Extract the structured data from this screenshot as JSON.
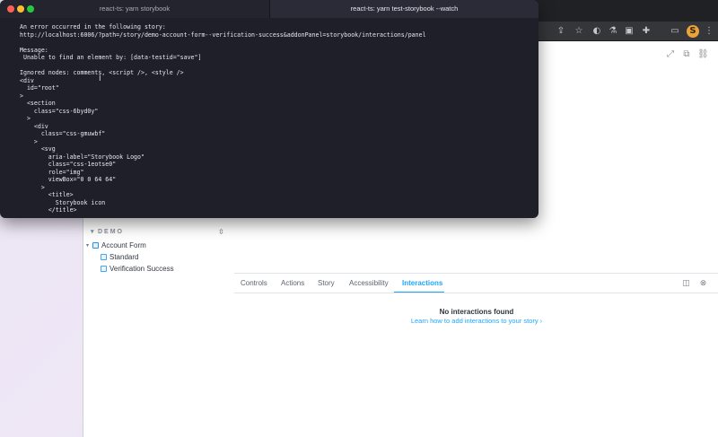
{
  "terminal": {
    "tab1_title": "react-ts: yarn storybook",
    "tab2_title": "react-ts: yarn test-storybook --watch",
    "lines": [
      "An error occurred in the following story:",
      "http://localhost:6006/?path=/story/demo-account-form--verification-success&addonPanel=storybook/interactions/panel",
      "",
      "Message:",
      " Unable to find an element by: [data-testid=\"save\"]",
      "",
      "Ignored nodes: comments, <script />, <style />",
      "<div",
      "  id=\"root\"",
      ">",
      "  <section",
      "    class=\"css-6byd0y\"",
      "  >",
      "    <div",
      "      class=\"css-gmuwbf\"",
      "    >",
      "      <svg",
      "        aria-label=\"Storybook Logo\"",
      "        class=\"css-1eotse0\"",
      "        role=\"img\"",
      "        viewBox=\"0 0 64 64\"",
      "      >",
      "        <title>",
      "          Storybook icon",
      "        </title>"
    ]
  },
  "browser": {
    "toolbar_icons": [
      "share-icon",
      "star-icon",
      "shield-icon",
      "flask-icon",
      "cup-icon",
      "puzzle-icon",
      "cast-icon",
      "avatar"
    ],
    "avatar_letter": "S",
    "preview_icons": [
      "fullscreen-icon",
      "open-new-icon",
      "link-icon"
    ]
  },
  "sidebar": {
    "section_label": "DEMO",
    "items": [
      {
        "label": "Account Form"
      },
      {
        "label": "Standard"
      },
      {
        "label": "Verification Success"
      }
    ]
  },
  "addon_panel": {
    "tabs": [
      "Controls",
      "Actions",
      "Story",
      "Accessibility",
      "Interactions"
    ],
    "active_tab": "Interactions",
    "empty_title": "No interactions found",
    "empty_link": "Learn how to add interactions to your story ›"
  },
  "colors": {
    "accent": "#1ea7fd",
    "terminal_bg": "#1e1f29",
    "close": "#ff5f57",
    "minimize": "#febc2e",
    "zoom": "#28c840"
  }
}
